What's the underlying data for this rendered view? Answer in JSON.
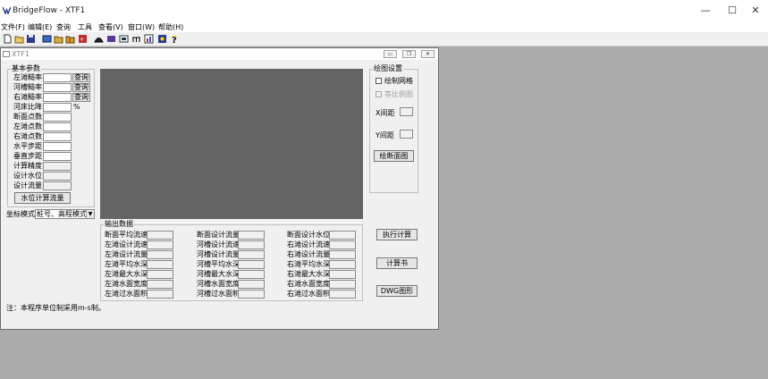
{
  "app": {
    "title": "BridgeFlow - XTF1",
    "window_controls": {
      "minimize": "—",
      "maximize": "☐",
      "close": "✕"
    }
  },
  "menu": [
    "文件(F)",
    "编辑(E)",
    "查询",
    "工具",
    "查看(V)",
    "窗口(W)",
    "帮助(H)"
  ],
  "child_window": {
    "title": "XTF1"
  },
  "basic_params": {
    "title": "基本参数",
    "rows": [
      {
        "label": "左滩糙率"
      },
      {
        "label": "河槽糙率"
      },
      {
        "label": "右滩糙率"
      },
      {
        "label": "河床比降"
      },
      {
        "label": "断面点数"
      },
      {
        "label": "左滩点数"
      },
      {
        "label": "右滩点数"
      },
      {
        "label": "水平步距"
      },
      {
        "label": "垂直步距"
      },
      {
        "label": "计算精度"
      },
      {
        "label": "设计水位"
      },
      {
        "label": "设计流量"
      }
    ],
    "query_label": "查询",
    "percent_unit": "%",
    "calc_button": "水位计算流量"
  },
  "coord_mode": {
    "label": "坐标模式",
    "value": "桩号、高程模式"
  },
  "drawing_settings": {
    "title": "绘图设置",
    "draw_grid": "绘制网格",
    "equal_ratio": "等比例图",
    "x_spacing": "X间距",
    "y_spacing": "Y间距",
    "draw_section_button": "绘断面图"
  },
  "output": {
    "title": "输出数据",
    "col1": [
      "断面平均流速",
      "左滩设计流速",
      "左滩设计流量",
      "左滩平均水深",
      "左滩最大水深",
      "左滩水面宽度",
      "左滩过水面积"
    ],
    "col2": [
      "断面设计流量",
      "河槽设计流速",
      "河槽设计流量",
      "河槽平均水深",
      "河槽最大水深",
      "河槽水面宽度",
      "河槽过水面积"
    ],
    "col3": [
      "断面设计水位",
      "右滩设计流速",
      "右滩设计流量",
      "右滩平均水深",
      "右滩最大水深",
      "右滩水面宽度",
      "右滩过水面积"
    ]
  },
  "actions": {
    "execute": "执行计算",
    "report": "计算书",
    "dwg": "DWG图形"
  },
  "note": "注：本程序单位制采用m-s制。"
}
